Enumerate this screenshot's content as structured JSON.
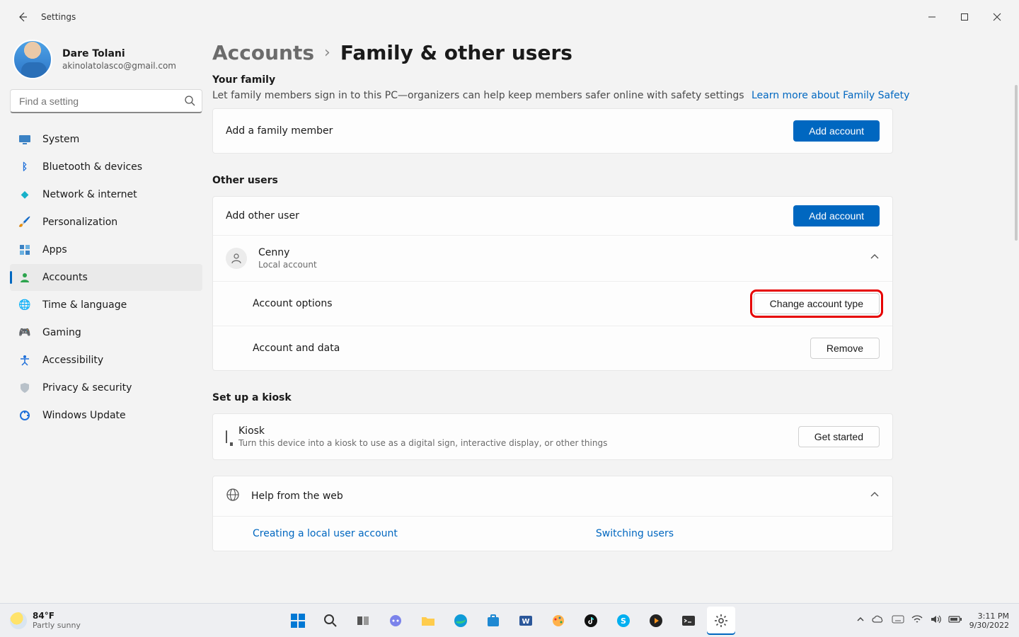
{
  "window": {
    "title": "Settings"
  },
  "profile": {
    "name": "Dare Tolani",
    "email": "akinolatolasco@gmail.com"
  },
  "search": {
    "placeholder": "Find a setting"
  },
  "nav": [
    {
      "label": "System",
      "icon": "🖥️"
    },
    {
      "label": "Bluetooth & devices",
      "icon": "ᛒ"
    },
    {
      "label": "Network & internet",
      "icon": "◆"
    },
    {
      "label": "Personalization",
      "icon": "🖌️"
    },
    {
      "label": "Apps",
      "icon": "▦"
    },
    {
      "label": "Accounts",
      "icon": "👤",
      "active": true
    },
    {
      "label": "Time & language",
      "icon": "🌐"
    },
    {
      "label": "Gaming",
      "icon": "🎮"
    },
    {
      "label": "Accessibility",
      "icon": "🕴"
    },
    {
      "label": "Privacy & security",
      "icon": "🛡"
    },
    {
      "label": "Windows Update",
      "icon": "🔄"
    }
  ],
  "breadcrumb": {
    "parent": "Accounts",
    "current": "Family & other users"
  },
  "family": {
    "header": "Your family",
    "desc": "Let family members sign in to this PC—organizers can help keep members safer online with safety settings",
    "link": "Learn more about Family Safety",
    "add_label": "Add a family member",
    "add_button": "Add account"
  },
  "other": {
    "header": "Other users",
    "add_label": "Add other user",
    "add_button": "Add account",
    "user": {
      "name": "Cenny",
      "type": "Local account"
    },
    "account_options": {
      "label": "Account options",
      "button": "Change account type"
    },
    "account_data": {
      "label": "Account and data",
      "button": "Remove"
    }
  },
  "kiosk": {
    "header": "Set up a kiosk",
    "title": "Kiosk",
    "desc": "Turn this device into a kiosk to use as a digital sign, interactive display, or other things",
    "button": "Get started"
  },
  "help": {
    "title": "Help from the web",
    "links": [
      "Creating a local user account",
      "Switching users"
    ]
  },
  "taskbar": {
    "weather_temp": "84°F",
    "weather_desc": "Partly sunny",
    "time": "3:11 PM",
    "date": "9/30/2022"
  }
}
